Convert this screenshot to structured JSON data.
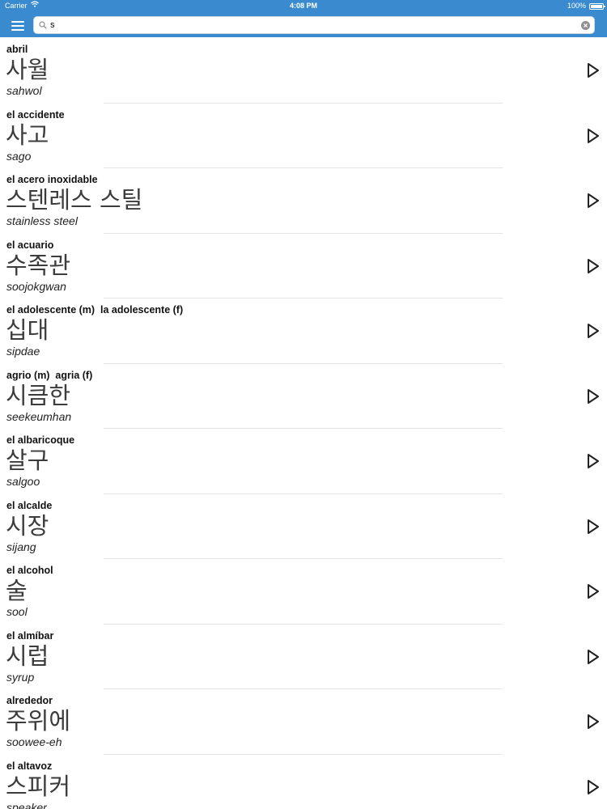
{
  "status_bar": {
    "carrier": "Carrier",
    "time": "4:08 PM",
    "battery": "100%"
  },
  "search": {
    "value": "s",
    "placeholder": ""
  },
  "entries": [
    {
      "spanish": "abril",
      "korean": "사월",
      "romanization": "sahwol"
    },
    {
      "spanish": "el accidente",
      "korean": "사고",
      "romanization": "sago"
    },
    {
      "spanish": "el acero inoxidable",
      "korean": "스텐레스 스틸",
      "romanization": "stainless steel"
    },
    {
      "spanish": "el acuario",
      "korean": "수족관",
      "romanization": "soojokgwan"
    },
    {
      "spanish": "el adolescente (m)  la adolescente (f)",
      "korean": "십대",
      "romanization": "sipdae"
    },
    {
      "spanish": "agrio (m)  agria (f)",
      "korean": "시큼한",
      "romanization": "seekeumhan"
    },
    {
      "spanish": "el albaricoque",
      "korean": "살구",
      "romanization": "salgoo"
    },
    {
      "spanish": "el alcalde",
      "korean": "시장",
      "romanization": "sijang"
    },
    {
      "spanish": "el alcohol",
      "korean": "술",
      "romanization": "sool"
    },
    {
      "spanish": "el almíbar",
      "korean": "시럽",
      "romanization": "syrup"
    },
    {
      "spanish": "alrededor",
      "korean": "주위에",
      "romanization": "soowee-eh"
    },
    {
      "spanish": "el altavoz",
      "korean": "스피커",
      "romanization": "speaker"
    }
  ],
  "colors": {
    "accent": "#3a8ad0"
  }
}
